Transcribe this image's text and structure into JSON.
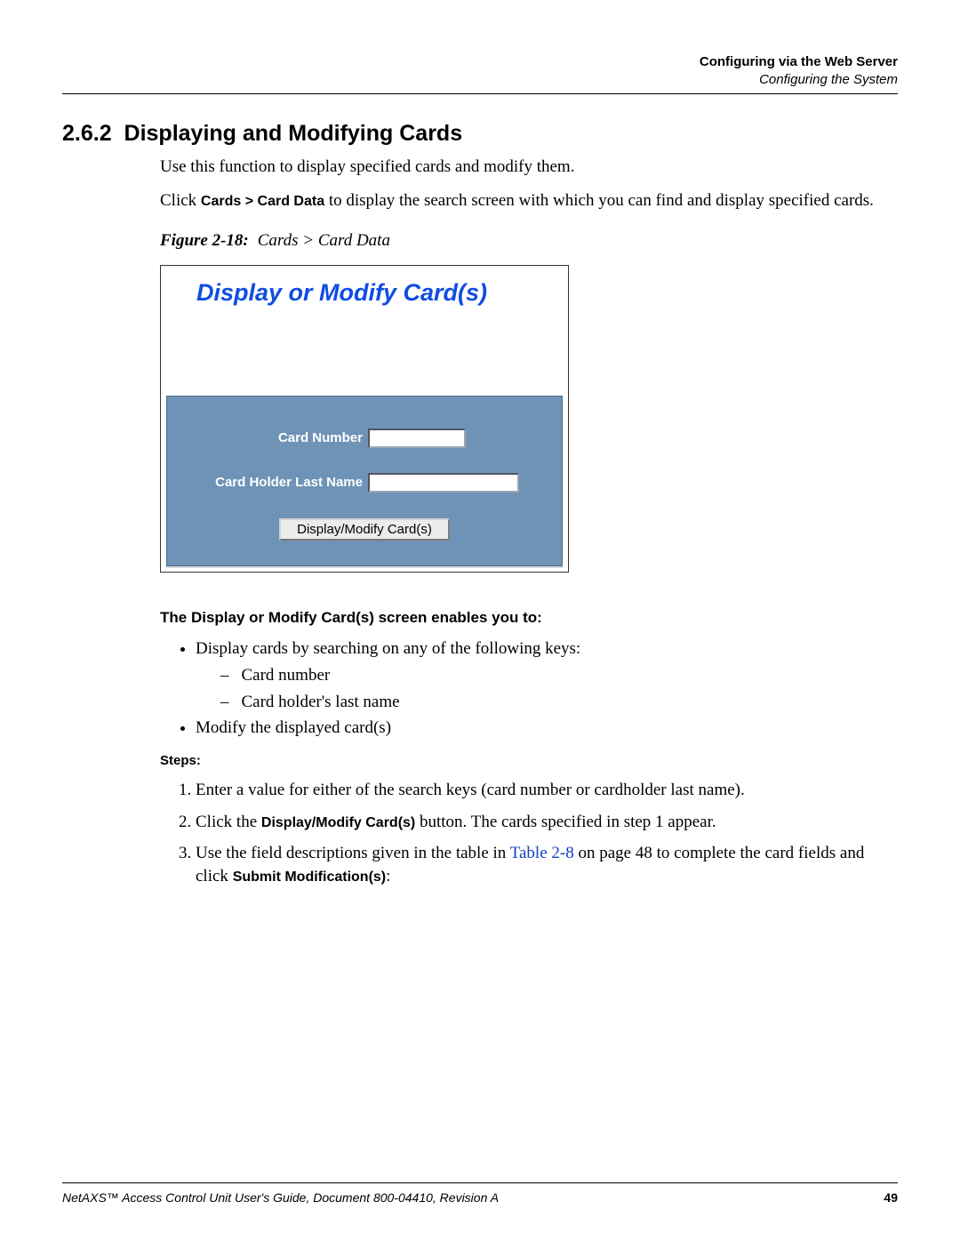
{
  "header": {
    "line1": "Configuring via the Web Server",
    "line2": "Configuring the System"
  },
  "section": {
    "number": "2.6.2",
    "title": "Displaying and Modifying Cards"
  },
  "intro": {
    "p1": "Use this function to display specified cards and modify them.",
    "p2_pre": "Click ",
    "p2_bold": "Cards > Card Data",
    "p2_post": " to display the search screen with which you can find and display specified cards."
  },
  "figure": {
    "label": "Figure 2-18:",
    "caption": "Cards > Card Data"
  },
  "screenshot": {
    "title": "Display or Modify Card(s)",
    "labels": {
      "card_number": "Card Number",
      "last_name": "Card Holder Last Name"
    },
    "button": "Display/Modify Card(s)"
  },
  "subheading": "The Display or Modify Card(s) screen enables you to:",
  "bullets": {
    "b1": "Display cards by searching on any of the following keys:",
    "b1a": "Card number",
    "b1b": "Card holder's last name",
    "b2": "Modify the displayed card(s)"
  },
  "steps_label": "Steps:",
  "steps": {
    "s1": "Enter a value for either of the search keys (card number or cardholder last name).",
    "s2_pre": "Click the ",
    "s2_bold": "Display/Modify Card(s)",
    "s2_post": " button. The cards specified in step 1 appear.",
    "s3_pre": "Use the field descriptions given in the table in ",
    "s3_link": "Table 2-8",
    "s3_mid": " on page 48 to complete the card fields and click ",
    "s3_bold": "Submit Modification(s)",
    "s3_post": ":"
  },
  "footer": {
    "doc": "NetAXS™ Access Control Unit User's Guide, Document 800-04410, Revision A",
    "page": "49"
  }
}
